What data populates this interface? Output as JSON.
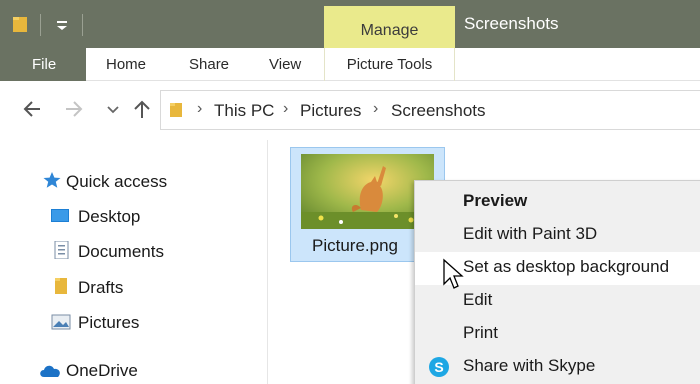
{
  "titlebar": {
    "window_title": "Screenshots",
    "contextual_tab": "Manage"
  },
  "ribbon": {
    "tabs": [
      "File",
      "Home",
      "Share",
      "View",
      "Picture Tools"
    ]
  },
  "address": {
    "crumbs": [
      "This PC",
      "Pictures",
      "Screenshots"
    ]
  },
  "navpane": {
    "items": [
      {
        "label": "Quick access",
        "icon": "star-icon"
      },
      {
        "label": "Desktop",
        "icon": "desktop-icon"
      },
      {
        "label": "Documents",
        "icon": "documents-icon"
      },
      {
        "label": "Drafts",
        "icon": "folder-icon"
      },
      {
        "label": "Pictures",
        "icon": "pictures-icon"
      },
      {
        "label": "OneDrive",
        "icon": "cloud-icon"
      }
    ]
  },
  "file": {
    "name": "Picture.png"
  },
  "context_menu": {
    "items": [
      {
        "label": "Preview"
      },
      {
        "label": "Edit with Paint 3D"
      },
      {
        "label": "Set as desktop background"
      },
      {
        "label": "Edit"
      },
      {
        "label": "Print"
      },
      {
        "label": "Share with Skype",
        "icon": "skype-icon"
      }
    ]
  },
  "colors": {
    "titlebar": "#6a7262",
    "manage_tab": "#eaea8c",
    "selection": "#cce5fb",
    "menu_bg": "#f0f0f0"
  }
}
